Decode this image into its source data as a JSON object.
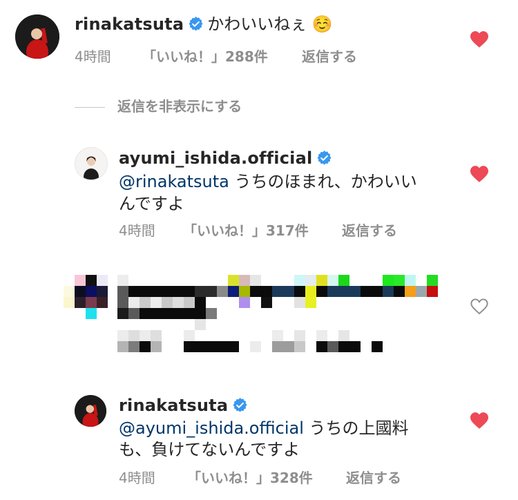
{
  "colors": {
    "heart_filled": "#ed4956",
    "verified": "#3897f0",
    "mention": "#003569",
    "meta": "#8e8e8e"
  },
  "comment1": {
    "username": "rinakatsuta",
    "text": "かわいいねぇ ☺️",
    "time": "4時間",
    "likes": "「いいね！」288件",
    "reply": "返信する"
  },
  "hide_replies": "返信を非表示にする",
  "reply1": {
    "username": "ayumi_ishida.official",
    "mention": "@rinakatsuta",
    "text_line1": " うちのほまれ、かわいい",
    "text_line2": "んですよ",
    "time": "4時間",
    "likes": "「いいね！」317件",
    "reply": "返信する"
  },
  "reply2": {
    "username": "rinakatsuta",
    "mention": "@ayumi_ishida.official",
    "text_line1": " うちの上國料",
    "text_line2": "も、負けてないんですよ",
    "time": "4時間",
    "likes": "「いいね！」328件",
    "reply": "返信する"
  },
  "icons": {
    "heart_liked": "heart-filled-icon",
    "heart_unliked": "heart-outline-icon",
    "verified": "verified-badge-icon"
  }
}
